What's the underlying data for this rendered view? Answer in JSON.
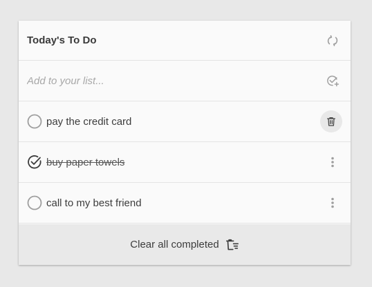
{
  "header": {
    "title": "Today's To Do",
    "refresh_icon": "sync-icon"
  },
  "add": {
    "placeholder": "Add to your list...",
    "icon": "add-task-icon"
  },
  "items": [
    {
      "text": "pay the credit card",
      "completed": false,
      "action_icon": "trash-icon"
    },
    {
      "text": "buy paper towels",
      "completed": true,
      "action_icon": "more-vertical-icon"
    },
    {
      "text": "call to my best friend",
      "completed": false,
      "action_icon": "more-vertical-icon"
    }
  ],
  "footer": {
    "clear_label": "Clear all completed",
    "clear_icon": "clear-completed-icon"
  },
  "colors": {
    "background": "#e8e8e8",
    "card": "#fafafa",
    "footer": "#e9e9e9",
    "icon": "#9e9e9e"
  }
}
